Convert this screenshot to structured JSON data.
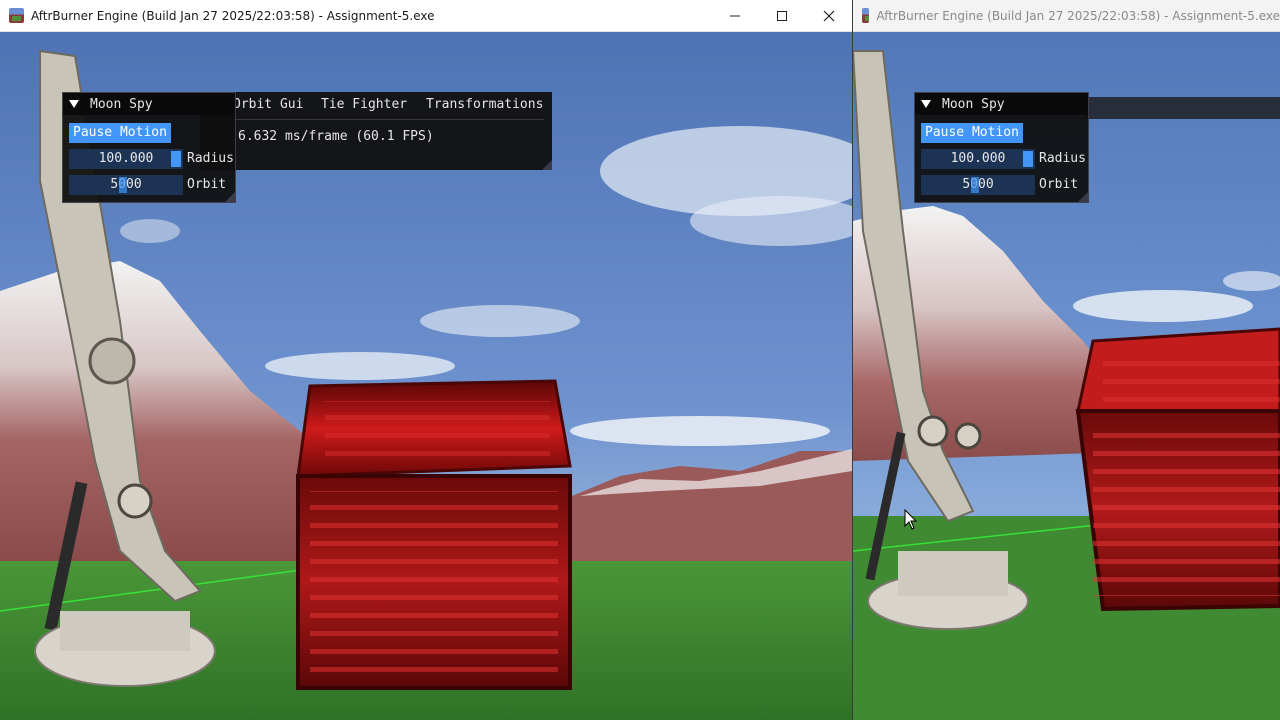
{
  "windows": [
    {
      "title": "AftrBurner Engine (Build Jan 27 2025/22:03:58) - Assignment-5.exe",
      "caption_buttons": [
        "minimize-icon",
        "maximize-icon",
        "close-icon"
      ],
      "moon_spy": {
        "title": "Moon Spy",
        "pause_label": "Pause Motion",
        "radius_value": "100.000",
        "radius_label": "Radius",
        "orbit_value": "5000",
        "orbit_label": "Orbit"
      },
      "main_bar": {
        "menus": [
          "Orbit Gui",
          "Tie Fighter",
          "Transformations"
        ],
        "fps_text": "6.632 ms/frame (60.1 FPS)"
      }
    },
    {
      "title": "AftrBurner Engine (Build Jan 27 2025/22:03:58) - Assignment-5.exe",
      "moon_spy": {
        "title": "Moon Spy",
        "pause_label": "Pause Motion",
        "radius_value": "100.000",
        "radius_label": "Radius",
        "orbit_value": "5000",
        "orbit_label": "Orbit"
      }
    }
  ],
  "colors": {
    "imgui_accent": "#4296fa",
    "imgui_frame": "#1d3354",
    "sky": "#5f84c6",
    "grass": "#3f8a33",
    "cube_red": "#b01818"
  }
}
